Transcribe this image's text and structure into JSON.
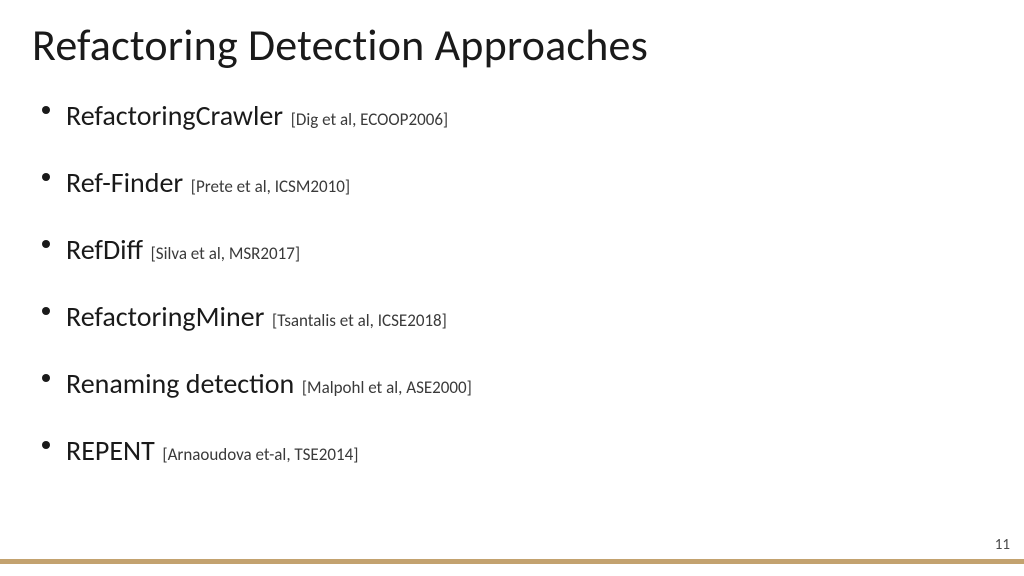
{
  "title": "Refactoring Detection Approaches",
  "items": [
    {
      "name": "RefactoringCrawler",
      "cite": "[Dig et al,  ECOOP2006]"
    },
    {
      "name": "Ref-Finder",
      "cite": "[Prete et al, ICSM2010]"
    },
    {
      "name": "RefDiff",
      "cite": "[Silva et al, MSR2017]"
    },
    {
      "name": "RefactoringMiner",
      "cite": "[Tsantalis et al, ICSE2018]"
    },
    {
      "name": "Renaming detection",
      "cite": "[Malpohl et al, ASE2000]"
    },
    {
      "name": "REPENT",
      "cite": "[Arnaoudova et-al, TSE2014]"
    }
  ],
  "page_number": "11",
  "accent_color": "#c3a26f"
}
